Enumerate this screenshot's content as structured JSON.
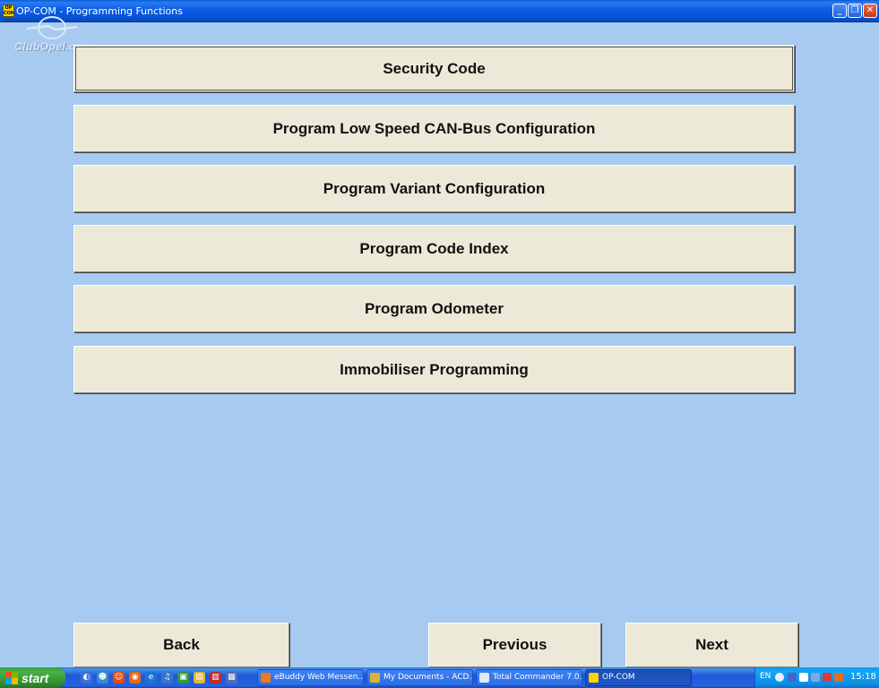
{
  "window": {
    "icon_label": "OP COM",
    "title": "OP-COM - Programming Functions",
    "min_glyph": "_",
    "max_glyph": "❐",
    "close_glyph": "✕"
  },
  "watermark": "ClubOpel.com",
  "functions": [
    {
      "label": "Security Code"
    },
    {
      "label": "Program Low Speed CAN-Bus Configuration"
    },
    {
      "label": "Program Variant Configuration"
    },
    {
      "label": "Program Code Index"
    },
    {
      "label": "Program Odometer"
    },
    {
      "label": "Immobiliser Programming"
    }
  ],
  "nav": {
    "back": "Back",
    "previous": "Previous",
    "next": "Next"
  },
  "taskbar": {
    "start": "start",
    "tasks": [
      {
        "label": "eBuddy Web Messen..."
      },
      {
        "label": "My Documents - ACD..."
      },
      {
        "label": "Total Commander 7.0..."
      },
      {
        "label": "OP-COM"
      }
    ],
    "tray_lang": "EN",
    "clock": "15:18"
  },
  "colors": {
    "desktop_bg": "#a6caf0",
    "button_face": "#ece9d8",
    "titlebar": "#0553d6"
  }
}
